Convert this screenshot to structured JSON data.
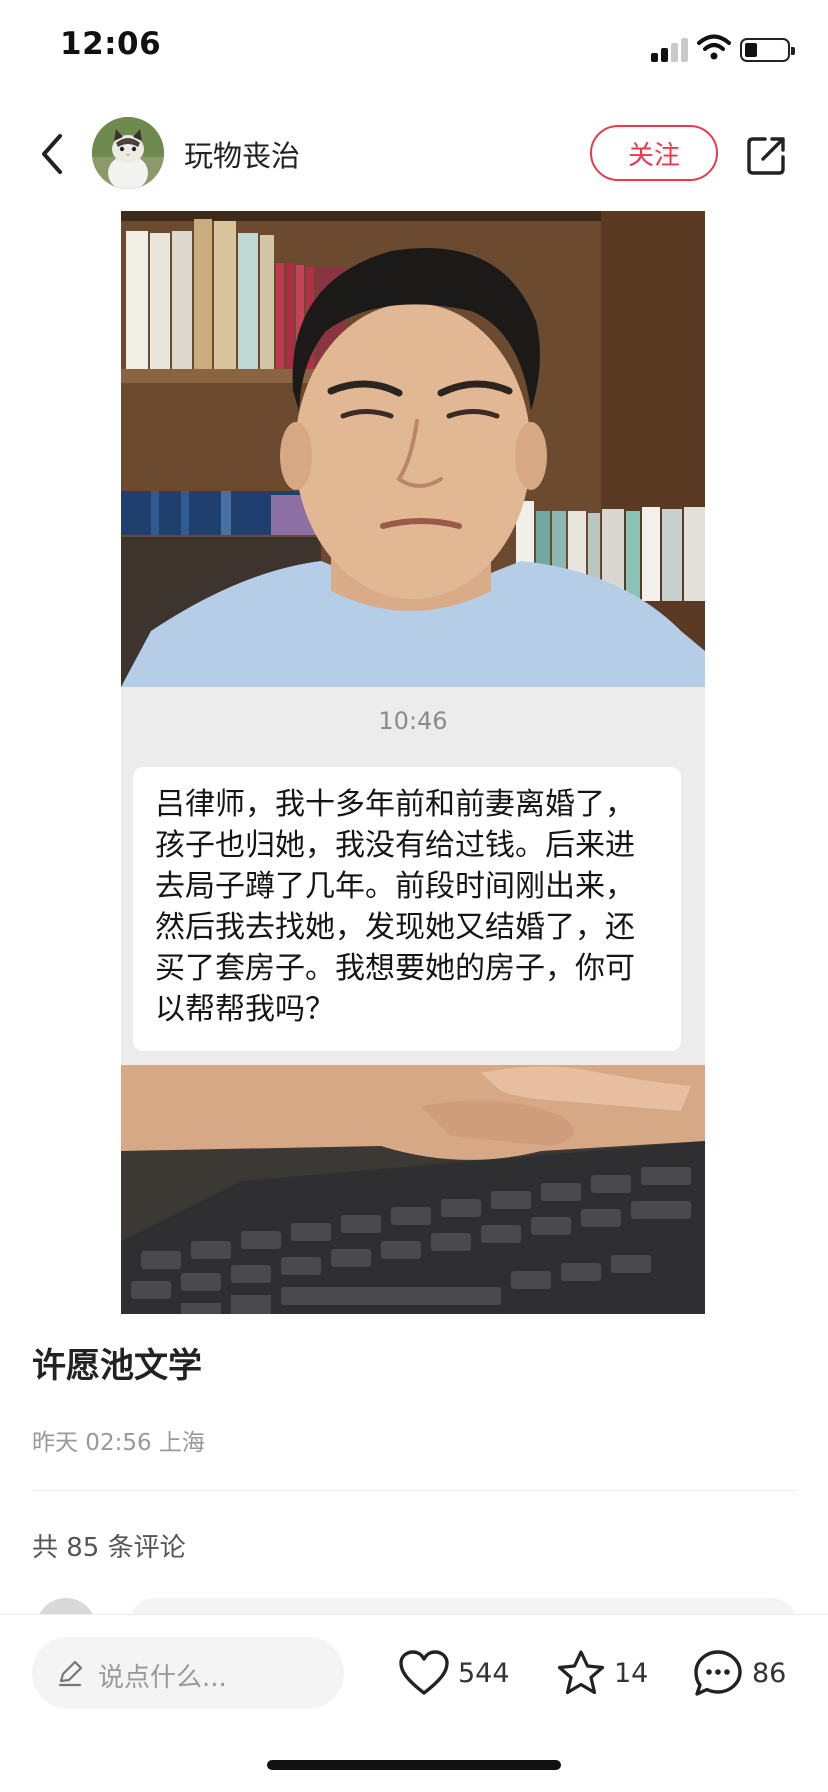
{
  "status_bar": {
    "time": "12:06",
    "icons": [
      "signal-icon",
      "wifi-icon",
      "battery-icon"
    ]
  },
  "header": {
    "username": "玩物丧治",
    "follow_label": "关注",
    "icons": [
      "back-icon",
      "share-icon"
    ]
  },
  "post": {
    "image": {
      "chat_time": "10:46",
      "chat_text": "吕律师，我十多年前和前妻离婚了，孩子也归她，我没有给过钱。后来进去局子蹲了几年。前段时间刚出来，然后我去找她，发现她又结婚了，还买了套房子。我想要她的房子，你可以帮帮我吗？"
    },
    "title": "许愿池文学",
    "meta": "昨天 02:56 上海",
    "comment_count_text": "共 85 条评论"
  },
  "bottom_bar": {
    "input_placeholder": "说点什么...",
    "likes": "544",
    "favorites": "14",
    "comments": "86"
  },
  "colors": {
    "accent": "#e8394d",
    "meta_text": "#999999",
    "chat_band": "#ececec"
  }
}
